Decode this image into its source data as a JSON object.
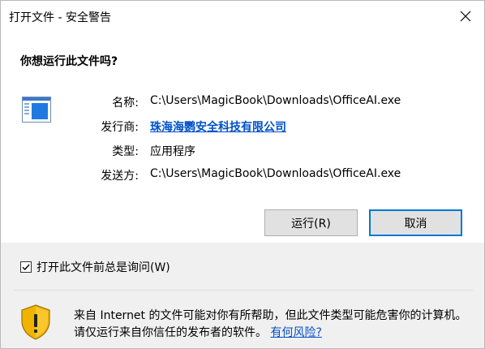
{
  "window": {
    "title": "打开文件 - 安全警告"
  },
  "dialog": {
    "question": "你想运行此文件吗?",
    "fields": [
      {
        "label": "名称:",
        "value": "C:\\Users\\MagicBook\\Downloads\\OfficeAI.exe"
      },
      {
        "label": "发行商:",
        "value": "珠海海鹦安全科技有限公司"
      },
      {
        "label": "类型:",
        "value": "应用程序"
      },
      {
        "label": "发送方:",
        "value": "C:\\Users\\MagicBook\\Downloads\\OfficeAI.exe"
      }
    ],
    "run_button": "运行(R)",
    "cancel_button": "取消",
    "checkbox_label": "打开此文件前总是询问(W)",
    "checkbox_checked": true
  },
  "warning": {
    "text": "来自 Internet 的文件可能对你有所帮助，但此文件类型可能危害你的计算机。请仅运行来自你信任的发布者的软件。",
    "link": "有何风险?"
  },
  "colors": {
    "accent": "#0078d7",
    "link": "#0050c8",
    "shield": "#f0b400"
  }
}
